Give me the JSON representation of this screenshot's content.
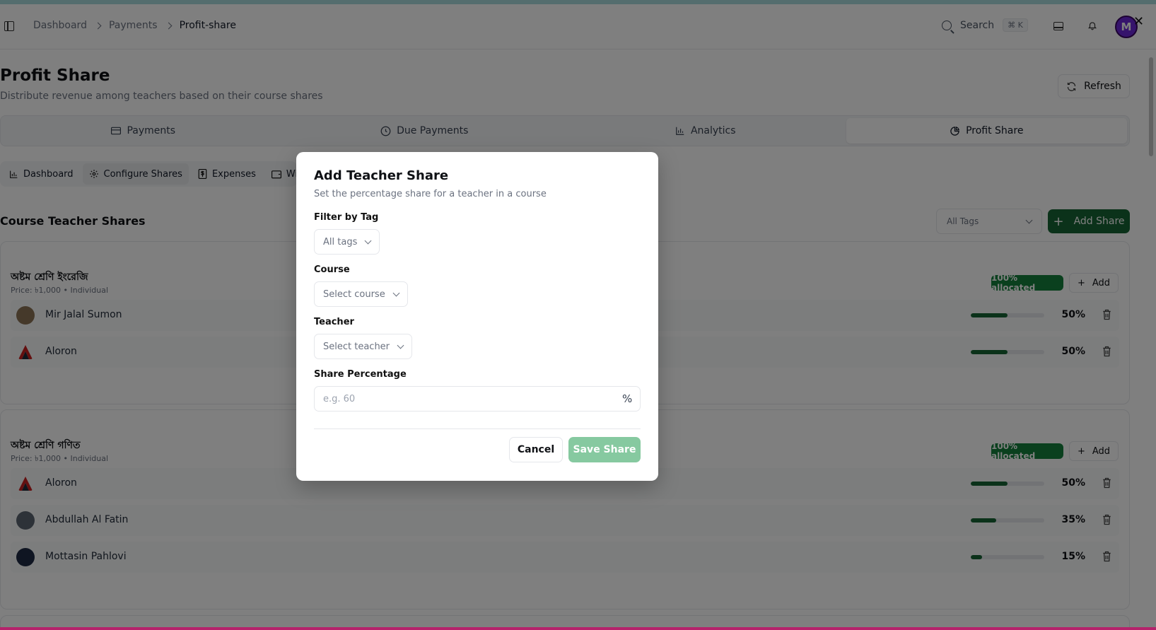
{
  "header": {
    "breadcrumb": [
      "Dashboard",
      "Payments",
      "Profit-share"
    ],
    "search_label": "Search",
    "search_shortcut": "⌘ K",
    "avatar_letter": "M"
  },
  "page": {
    "title": "Profit Share",
    "subtitle": "Distribute revenue among teachers based on their course shares",
    "refresh_label": "Refresh"
  },
  "main_tabs": [
    {
      "label": "Payments",
      "icon": "card-icon"
    },
    {
      "label": "Due Payments",
      "icon": "clock-icon"
    },
    {
      "label": "Analytics",
      "icon": "bar-chart-icon"
    },
    {
      "label": "Profit Share",
      "icon": "pie-icon",
      "active": true
    }
  ],
  "sub_tabs": [
    {
      "label": "Dashboard",
      "icon": "bar-chart-icon"
    },
    {
      "label": "Configure Shares",
      "icon": "gear-icon",
      "active": true
    },
    {
      "label": "Expenses",
      "icon": "dollar-icon"
    },
    {
      "label": "Withdra",
      "icon": "wallet-icon"
    }
  ],
  "section": {
    "title": "Course Teacher Shares",
    "tags_select": "All Tags",
    "add_share_label": "Add Share"
  },
  "courses": [
    {
      "name": "অষ্টম শ্রেণি ইংরেজি",
      "meta": "Price: ৳1,000 • Individual",
      "badge": "100% allocated",
      "add_label": "Add",
      "teachers": [
        {
          "name": "Mir Jalal Sumon",
          "percent": 50,
          "percent_label": "50%"
        },
        {
          "name": "Aloron",
          "percent": 50,
          "percent_label": "50%"
        }
      ]
    },
    {
      "name": "অষ্টম শ্রেণি গণিত",
      "meta": "Price: ৳1,000 • Individual",
      "badge": "100% allocated",
      "add_label": "Add",
      "teachers": [
        {
          "name": "Aloron",
          "percent": 50,
          "percent_label": "50%"
        },
        {
          "name": "Abdullah Al Fatin",
          "percent": 35,
          "percent_label": "35%"
        },
        {
          "name": "Mottasin Pahlovi",
          "percent": 15,
          "percent_label": "15%"
        }
      ]
    }
  ],
  "modal": {
    "title": "Add Teacher Share",
    "description": "Set the percentage share for a teacher in a course",
    "filter_label": "Filter by Tag",
    "filter_value": "All tags",
    "course_label": "Course",
    "course_placeholder": "Select course",
    "teacher_label": "Teacher",
    "teacher_placeholder": "Select teacher",
    "share_label": "Share Percentage",
    "share_placeholder": "e.g. 60",
    "share_suffix": "%",
    "cancel_label": "Cancel",
    "save_label": "Save Share"
  },
  "colors": {
    "accent": "#166534",
    "badge": "#15803d",
    "save_disabled": "#86c9a0",
    "avatar": "#6d28d9"
  }
}
